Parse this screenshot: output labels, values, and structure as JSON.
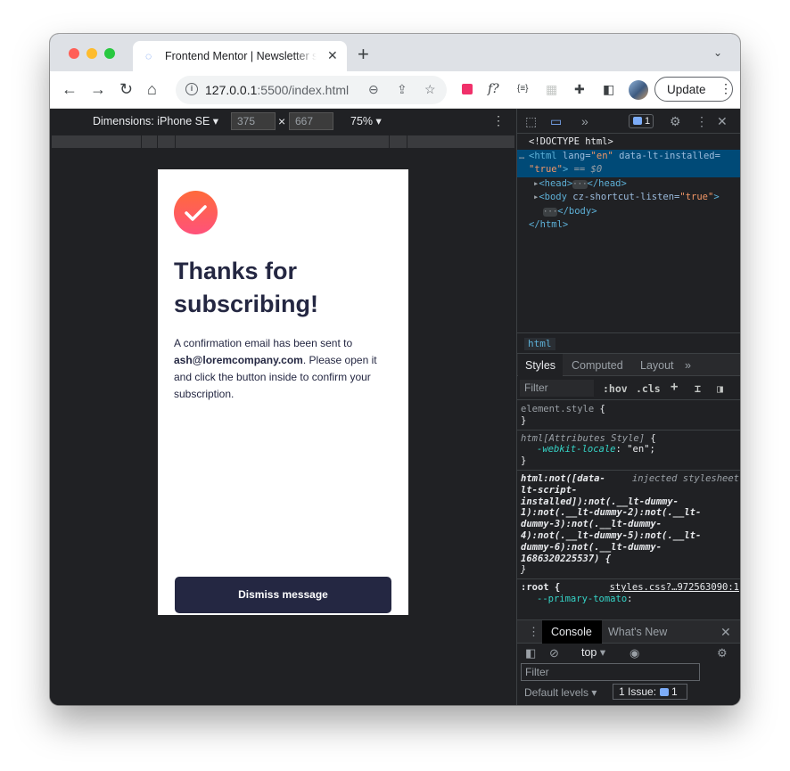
{
  "browser": {
    "tab_title": "Frontend Mentor | Newsletter sign-up form with success message",
    "tab_close": "✕",
    "new_tab": "+",
    "url_host": "127.0.0.1",
    "url_path": ":5500/index.html",
    "update_label": "Update",
    "traffic_lights": {
      "close": "#ff5f57",
      "minimize": "#febc2e",
      "maximize": "#28c840"
    }
  },
  "device_toolbar": {
    "dimensions_label": "Dimensions: iPhone SE",
    "width": "375",
    "height": "667",
    "times": "×",
    "zoom": "75%"
  },
  "page": {
    "title": "Thanks for subscribing!",
    "body_prefix": "A confirmation email has been sent to ",
    "email": "ash@loremcompany.com",
    "body_suffix": ". Please open it and click the button inside to confirm your subscription.",
    "dismiss_label": "Dismiss message",
    "colors": {
      "dark_navy": "#242742",
      "tomato": "#ff6155"
    }
  },
  "devtools": {
    "issues_badge": "1",
    "dom": {
      "doctype": "<!DOCTYPE html>",
      "html_open_tag": "<html",
      "html_lang_attr": " lang=",
      "html_lang_val": "\"en\"",
      "html_lt_attr": " data-lt-installed=",
      "html_lt_val": "\"true\"",
      "html_close_bracket": ">",
      "html_eq": " == $0",
      "head_open": "<head>",
      "head_close": "</head>",
      "body_open": "<body",
      "body_attr": " cz-shortcut-listen=",
      "body_val": "\"true\"",
      "body_gt": ">",
      "body_close": "</body>",
      "html_close": "</html>",
      "ellipsis": "···"
    },
    "breadcrumb": "html",
    "subtabs": [
      "Styles",
      "Computed",
      "Layout"
    ],
    "filter_placeholder": "Filter",
    "hov": ":hov",
    "cls": ".cls",
    "styles": {
      "r1_selector": "element.style",
      "r2_selector": "html[Attributes Style]",
      "r2_prop": "-webkit-locale",
      "r2_val": "\"en\"",
      "r3_selector_l1": "html:not([data-",
      "r3_source": "injected stylesheet",
      "r3_selector_l2": "lt-script-",
      "r3_selector_l3": "installed]):not(.__lt-dummy-",
      "r3_selector_l4": "1):not(.__lt-dummy-2):not(.__lt-",
      "r3_selector_l5": "dummy-3):not(.__lt-dummy-",
      "r3_selector_l6": "4):not(.__lt-dummy-5):not(.__lt-",
      "r3_selector_l7": "dummy-6):not(.__lt-dummy-",
      "r3_selector_l8": "1686320225537) {",
      "r4_selector": ":root {",
      "r4_source": "styles.css?…972563090:1",
      "r4_prop": "--primary-tomato",
      "open_brace": " {",
      "close_brace": "}"
    },
    "drawer": {
      "tabs": [
        "Console",
        "What's New"
      ],
      "context": "top",
      "filter_placeholder": "Filter",
      "levels": "Default levels ▾",
      "issues_label": "1 Issue:",
      "issues_count": "1"
    }
  }
}
